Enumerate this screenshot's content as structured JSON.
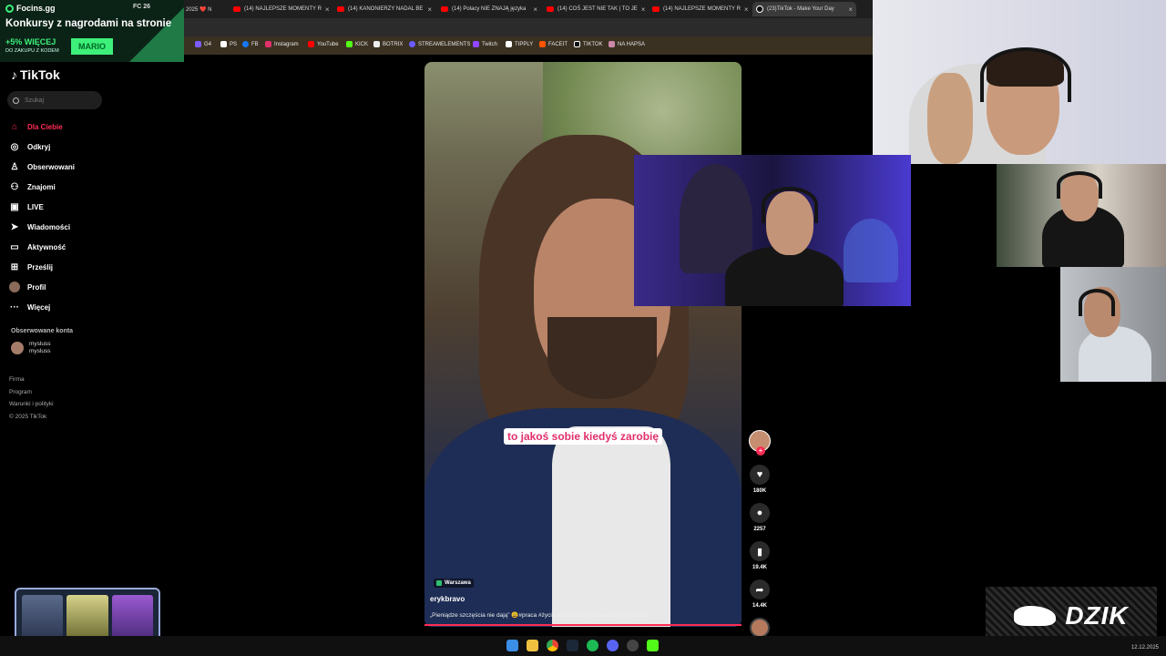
{
  "browser": {
    "tabs": [
      {
        "title": "2025 ❤️ N",
        "icon": "pinned"
      },
      {
        "title": "(14) NAJLEPSZE MOMENTY R",
        "icon": "youtube"
      },
      {
        "title": "(14) KANONIERZY NADAL BE",
        "icon": "youtube"
      },
      {
        "title": "(14) Polacy NIE ZNAJĄ języka",
        "icon": "youtube"
      },
      {
        "title": "(14) COŚ JEST NIE TAK | TO JE",
        "icon": "youtube"
      },
      {
        "title": "(14) NAJLEPSZE MOMENTY R",
        "icon": "youtube"
      },
      {
        "title": "(23)TikTok - Make Your Day",
        "icon": "tiktok"
      }
    ],
    "bookmarks": [
      "G4",
      "PS",
      "FB",
      "Instagram",
      "YouTube",
      "KICK",
      "BOTRIX",
      "STREAMELEMENTS",
      "Twitch",
      "TIPPLY",
      "FACEIT",
      "TIKTOK",
      "NA HAPSA"
    ]
  },
  "promo": {
    "brand": "Focins.gg",
    "system": "FC 26",
    "headline": "Konkursy z nagrodami na stronie",
    "bonus": "+5% WIĘCEJ",
    "bonus_sub": "DO ZAKUPU Z KODEM",
    "code": "MARIO"
  },
  "tiktok": {
    "logo": "TikTok",
    "search_placeholder": "Szukaj",
    "nav": [
      {
        "label": "Dla Ciebie",
        "icon": "home-icon",
        "active": true
      },
      {
        "label": "Odkryj",
        "icon": "compass-icon"
      },
      {
        "label": "Obserwowani",
        "icon": "user-follow-icon"
      },
      {
        "label": "Znajomi",
        "icon": "friends-icon"
      },
      {
        "label": "LIVE",
        "icon": "live-icon"
      },
      {
        "label": "Wiadomości",
        "icon": "send-icon"
      },
      {
        "label": "Aktywność",
        "icon": "inbox-icon"
      },
      {
        "label": "Prześlij",
        "icon": "upload-icon"
      },
      {
        "label": "Profil",
        "icon": "avatar"
      },
      {
        "label": "Więcej",
        "icon": "more-icon"
      }
    ],
    "followed_header": "Obserwowane konta",
    "followed": [
      {
        "name": "mysluss",
        "handle": "mysluss"
      }
    ],
    "footer": [
      "Firma",
      "Program",
      "Warunki i polityki",
      "© 2025 TikTok"
    ]
  },
  "video": {
    "subtitle": "to jakoś sobie kiedyś zarobię",
    "location": "Warszawa",
    "author": "erykbravo",
    "caption": "„Pieniądze szczęścia nie dają” 😩#praca #życie #szczęście #pieniądze #erykbravo",
    "likes": "180K",
    "comments": "2257",
    "saves": "19.4K",
    "shares": "14.4K"
  },
  "overlay": {
    "sponsor": "DZIK"
  },
  "taskbar": {
    "date": "12.12.2025"
  },
  "colors": {
    "accent": "#fe2c55",
    "promo_green": "#3df07a"
  }
}
